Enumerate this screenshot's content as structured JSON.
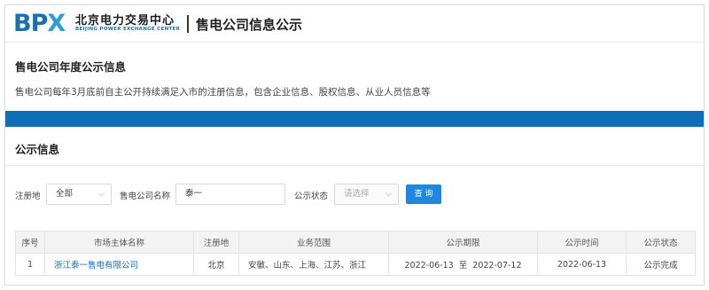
{
  "header": {
    "logo_mark": "BPX",
    "logo_cn": "北京电力交易中心",
    "logo_en": "BEIJING POWER EXCHANGE CENTER",
    "title": "售电公司信息公示"
  },
  "annual": {
    "title": "售电公司年度公示信息",
    "description": "售电公司每年3月底前自主公开持续满足入市的注册信息，包含企业信息、股权信息、从业人员信息等"
  },
  "section": {
    "title": "公示信息"
  },
  "filters": {
    "region_label": "注册地",
    "region_value": "全部",
    "company_label": "售电公司名称",
    "company_value": "泰一",
    "status_label": "公示状态",
    "status_placeholder": "请选择",
    "search_button": "查 询"
  },
  "table": {
    "headers": [
      "序号",
      "市场主体名称",
      "注册地",
      "业务范围",
      "公示期限",
      "公示时间",
      "公示状态"
    ],
    "rows": [
      {
        "index": "1",
        "name": "浙江泰一售电有限公司",
        "region": "北京",
        "scope": "安徽、山东、上海、江苏、浙江",
        "period": "2022-06-13  至  2022-07-12",
        "date": "2022-06-13",
        "status": "公示完成"
      }
    ]
  },
  "colors": {
    "brand_blue": "#0f6eb8",
    "link_blue": "#1a6fb3",
    "button_blue": "#1e87e0"
  }
}
